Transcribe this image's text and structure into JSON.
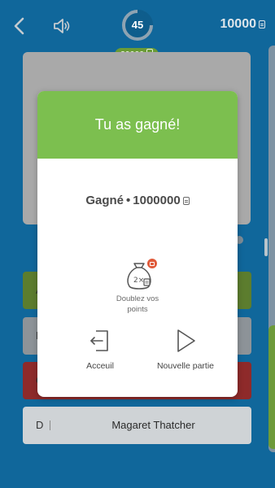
{
  "topbar": {
    "timer_value": "45",
    "reward_pill": "20000",
    "coins": "10000"
  },
  "answers": [
    {
      "letter": "A",
      "text": ""
    },
    {
      "letter": "B",
      "text": ""
    },
    {
      "letter": "C",
      "text": ""
    },
    {
      "letter": "D",
      "text": "Magaret Thatcher"
    }
  ],
  "modal": {
    "title": "Tu as gagné!",
    "won_label": "Gagné",
    "won_separator": "•",
    "won_amount": "1000000",
    "double_label_line1": "Doublez vos",
    "double_label_line2": "points",
    "home_label": "Acceuil",
    "new_game_label": "Nouvelle partie"
  },
  "colors": {
    "background": "#10679b",
    "header_green": "#7cbf4f",
    "correct_green": "#5c7d2e",
    "wrong_red": "#8e2a2a"
  },
  "icons": [
    "back-icon",
    "speaker-icon",
    "timer-ring-icon",
    "coin-icon",
    "money-bag-icon",
    "tv-icon",
    "exit-door-icon",
    "play-icon"
  ]
}
